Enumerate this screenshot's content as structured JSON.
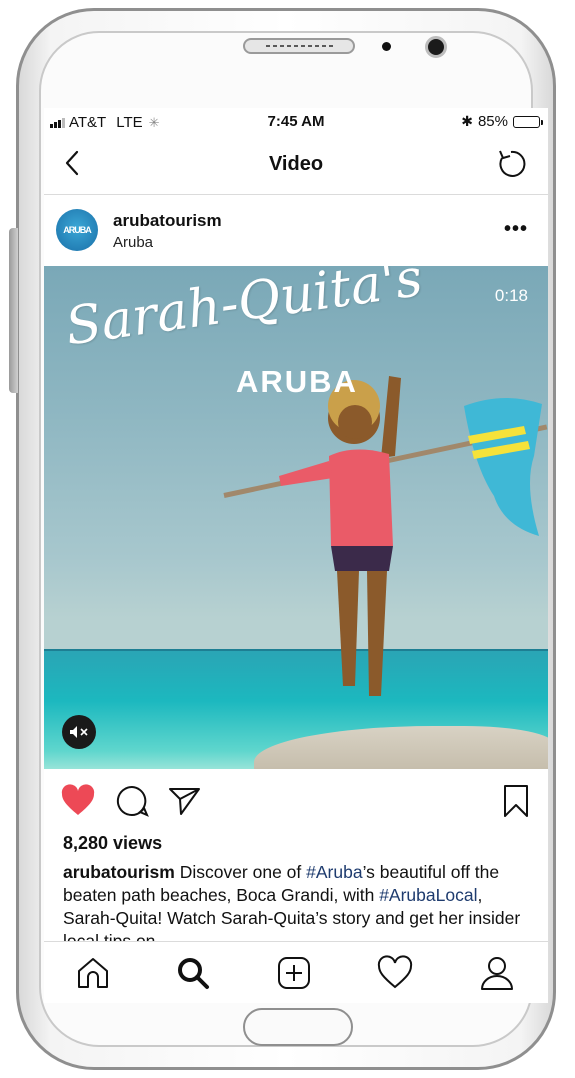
{
  "status_bar": {
    "carrier": "AT&T",
    "network": "LTE",
    "time": "7:45 AM",
    "battery": "85%",
    "battery_level": 0.85
  },
  "nav": {
    "title": "Video",
    "back_icon": "chevron-left-icon",
    "refresh_icon": "refresh-icon"
  },
  "post": {
    "avatar_text": "ARUBA",
    "username": "arubatourism",
    "location": "Aruba",
    "more_label": "•••"
  },
  "video": {
    "overlay_title": "Sarah-Quita's",
    "overlay_subtitle": "ARUBA",
    "duration": "0:18",
    "mute_icon": "muted-speaker-icon"
  },
  "actions": {
    "like_icon": "heart-filled-icon",
    "like_color": "#ed4956",
    "comment_icon": "comment-icon",
    "share_icon": "send-icon",
    "save_icon": "bookmark-icon"
  },
  "stats": {
    "views": "8,280 views"
  },
  "caption": {
    "username": "arubatourism",
    "part1": " Discover one of ",
    "tag1": "#Aruba",
    "part2": "’s beautiful off the beaten path beaches, Boca Grandi, with ",
    "tag2": "#ArubaLocal",
    "part3": ", Sarah-Quita! Watch Sarah-Quita’s story and get her insider local tips on",
    "tag_color": "#1e3b6e"
  },
  "tab_bar": {
    "items": [
      "home-icon",
      "search-icon",
      "new-post-icon",
      "activity-heart-icon",
      "profile-icon"
    ]
  }
}
